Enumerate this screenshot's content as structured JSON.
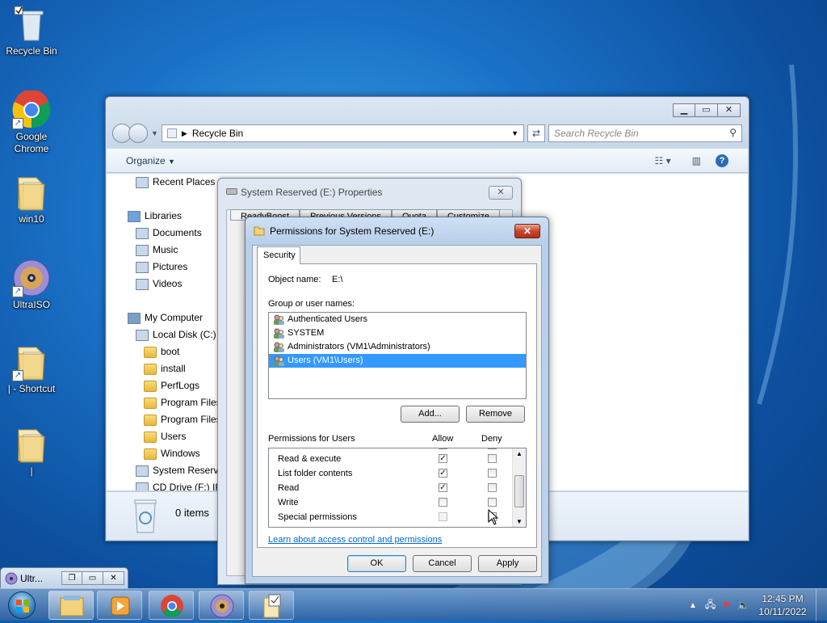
{
  "desktop": {
    "icons": [
      {
        "label": "Recycle Bin",
        "icon": "recycle-bin-icon"
      },
      {
        "label": "Google Chrome",
        "icon": "chrome-icon"
      },
      {
        "label": "win10",
        "icon": "folder-icon"
      },
      {
        "label": "UltraISO",
        "icon": "disc-icon"
      },
      {
        "label": "| - Shortcut",
        "icon": "folder-icon"
      },
      {
        "label": "|",
        "icon": "folder-icon"
      }
    ]
  },
  "explorer": {
    "address": "Recycle Bin",
    "search_placeholder": "Search Recycle Bin",
    "organize_label": "Organize",
    "nav": [
      {
        "label": "Recent Places",
        "indent": 1
      },
      {
        "label": "Libraries",
        "indent": 0
      },
      {
        "label": "Documents",
        "indent": 1
      },
      {
        "label": "Music",
        "indent": 1
      },
      {
        "label": "Pictures",
        "indent": 1
      },
      {
        "label": "Videos",
        "indent": 1
      },
      {
        "label": "My Computer",
        "indent": 0
      },
      {
        "label": "Local Disk (C:)",
        "indent": 1
      },
      {
        "label": "boot",
        "indent": 2
      },
      {
        "label": "install",
        "indent": 2
      },
      {
        "label": "PerfLogs",
        "indent": 2
      },
      {
        "label": "Program Files",
        "indent": 2
      },
      {
        "label": "Program Files",
        "indent": 2
      },
      {
        "label": "Users",
        "indent": 2
      },
      {
        "label": "Windows",
        "indent": 2
      },
      {
        "label": "System Reserve",
        "indent": 1
      },
      {
        "label": "CD Drive (F:) IRS",
        "indent": 1
      }
    ],
    "status": "0 items"
  },
  "properties_dialog": {
    "title": "System Reserved (E:) Properties",
    "tabs": [
      "ReadyBoost",
      "Previous Versions",
      "Quota",
      "Customize"
    ]
  },
  "permissions_dialog": {
    "title": "Permissions for System Reserved (E:)",
    "tab": "Security",
    "object_label": "Object name:",
    "object_value": "E:\\",
    "group_label": "Group or user names:",
    "users": [
      {
        "name": "Authenticated Users",
        "selected": false
      },
      {
        "name": "SYSTEM",
        "selected": false
      },
      {
        "name": "Administrators (VM1\\Administrators)",
        "selected": false
      },
      {
        "name": "Users (VM1\\Users)",
        "selected": true
      }
    ],
    "add_label": "Add...",
    "remove_label": "Remove",
    "perms_label": "Permissions for Users",
    "allow_label": "Allow",
    "deny_label": "Deny",
    "permissions": [
      {
        "name": "Read & execute",
        "allow": true,
        "deny": false,
        "enabled": true
      },
      {
        "name": "List folder contents",
        "allow": true,
        "deny": false,
        "enabled": true
      },
      {
        "name": "Read",
        "allow": true,
        "deny": false,
        "enabled": true
      },
      {
        "name": "Write",
        "allow": false,
        "deny": false,
        "enabled": true
      },
      {
        "name": "Special permissions",
        "allow": false,
        "deny": false,
        "enabled": false
      }
    ],
    "link": "Learn about access control and permissions",
    "ok_label": "OK",
    "cancel_label": "Cancel",
    "apply_label": "Apply"
  },
  "minimized_window": {
    "title": "Ultr..."
  },
  "taskbar": {
    "apps": [
      "explorer-icon",
      "media-player-icon",
      "chrome-icon",
      "ultraiso-icon",
      "folder-icon"
    ],
    "time": "12:45 PM",
    "date": "10/11/2022"
  }
}
